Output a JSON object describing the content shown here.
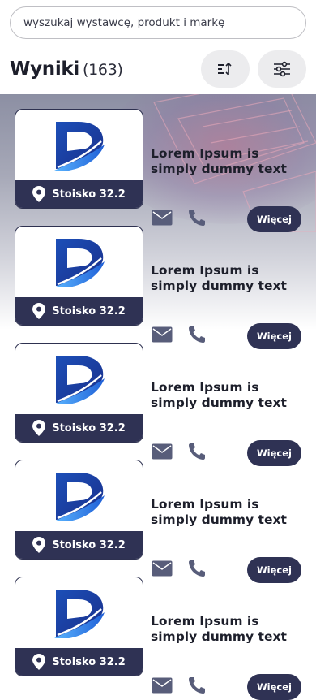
{
  "search": {
    "placeholder": "wyszukaj wystawcę, produkt i markę"
  },
  "header": {
    "title": "Wyniki",
    "count": "(163)"
  },
  "colors": {
    "accent": "#2f3254",
    "logo_blue": "#1f5fd6"
  },
  "results": [
    {
      "name": "Lorem Ipsum is simply dummy text",
      "stand": "Stoisko 32.2",
      "more_label": "Więcej"
    },
    {
      "name": "Lorem Ipsum is simply dummy text",
      "stand": "Stoisko 32.2",
      "more_label": "Więcej"
    },
    {
      "name": "Lorem Ipsum is simply dummy text",
      "stand": "Stoisko 32.2",
      "more_label": "Więcej"
    },
    {
      "name": "Lorem Ipsum is simply dummy text",
      "stand": "Stoisko 32.2",
      "more_label": "Więcej"
    },
    {
      "name": "Lorem Ipsum is simply dummy text",
      "stand": "Stoisko 32.2",
      "more_label": "Więcej"
    }
  ]
}
